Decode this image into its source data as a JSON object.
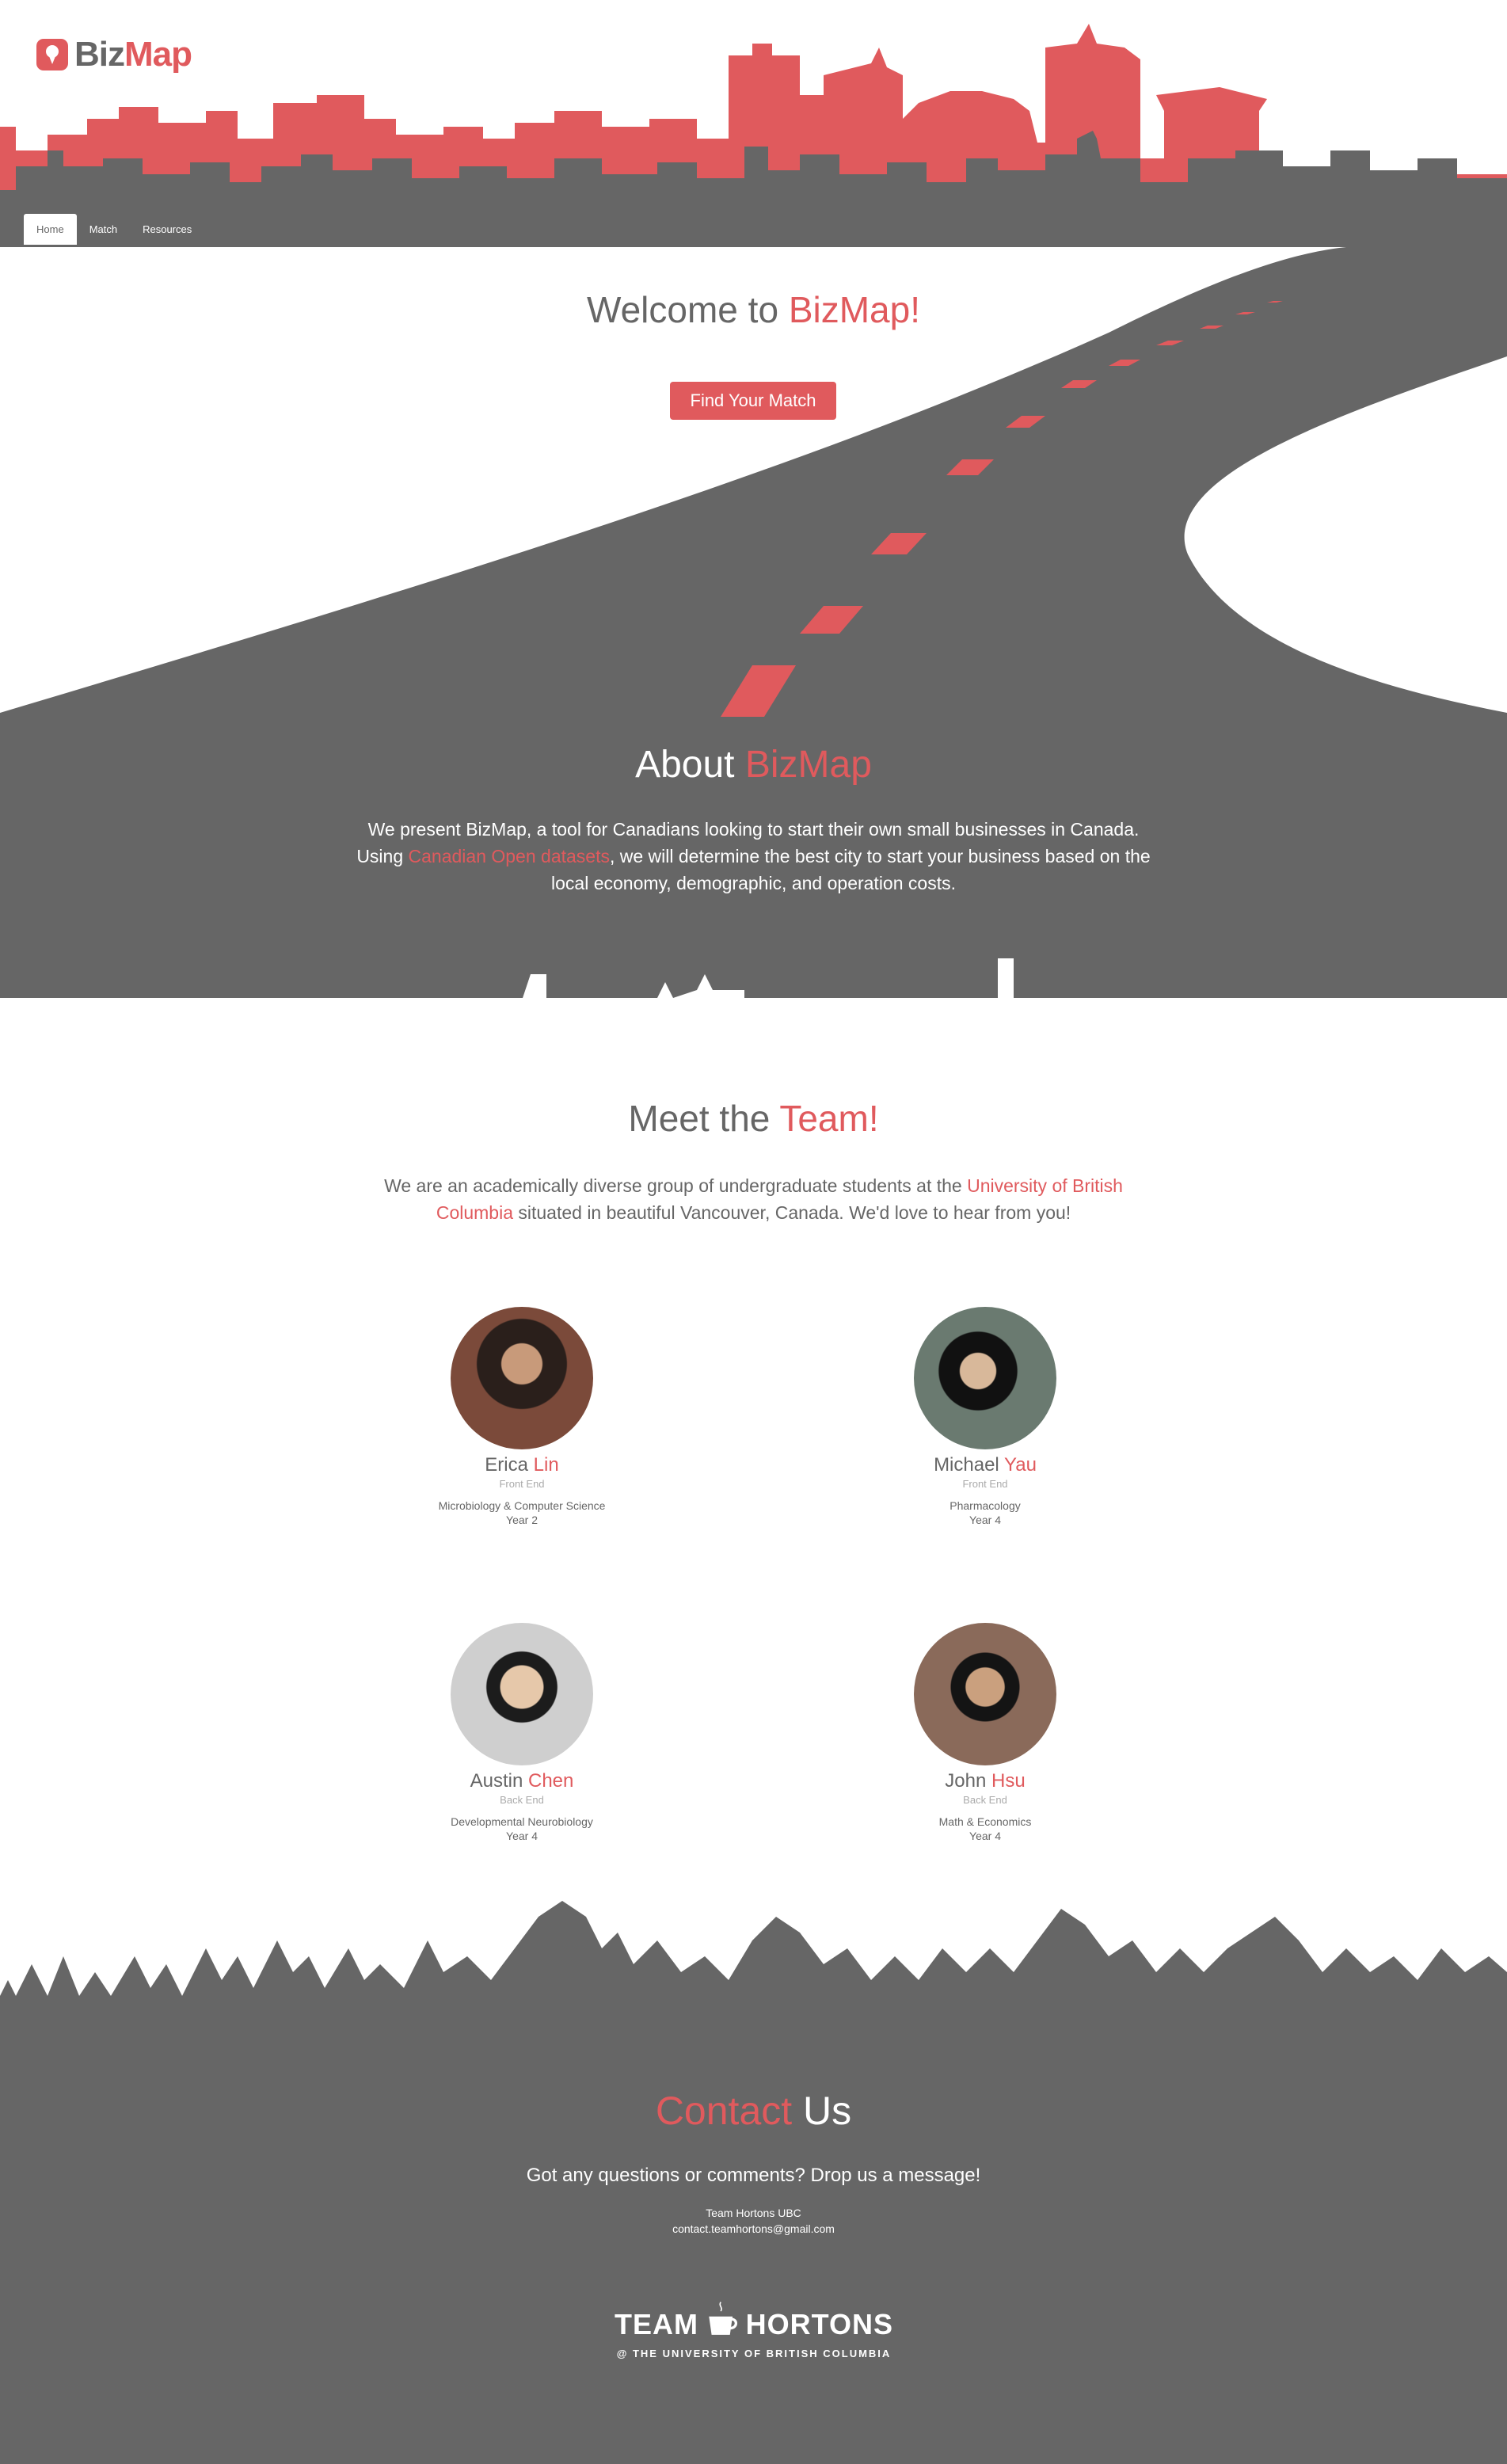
{
  "brand": {
    "logo_biz": "Biz",
    "logo_map": "Map"
  },
  "nav": {
    "items": [
      "Home",
      "Match",
      "Resources"
    ],
    "active": "Home"
  },
  "hero": {
    "title_prefix": "Welcome to ",
    "title_accent": "BizMap!",
    "cta_label": "Find Your Match"
  },
  "about": {
    "title_prefix": "About ",
    "title_accent": "BizMap",
    "line1": "We present BizMap, a tool for Canadians looking to start their own small businesses in Canada.",
    "line2_prefix": "Using ",
    "line2_link": "Canadian Open datasets",
    "line2_suffix": ", we will determine the best city to start your business based on the",
    "line3": "local economy, demographic, and operation costs."
  },
  "team": {
    "title_prefix": "Meet the ",
    "title_accent": "Team!",
    "intro_prefix": "We are an academically diverse group of undergraduate students at the ",
    "intro_link_1": "University of British",
    "intro_link_2": "Columbia",
    "intro_suffix": " situated in beautiful Vancouver, Canada. We'd love to hear from you!",
    "members": [
      {
        "first": "Erica",
        "last": "Lin",
        "role": "Front End",
        "major": "Microbiology & Computer Science",
        "year": "Year 2"
      },
      {
        "first": "Michael",
        "last": "Yau",
        "role": "Front End",
        "major": "Pharmacology",
        "year": "Year 4"
      },
      {
        "first": "Austin",
        "last": "Chen",
        "role": "Back End",
        "major": "Developmental Neurobiology",
        "year": "Year 4"
      },
      {
        "first": "John",
        "last": "Hsu",
        "role": "Back End",
        "major": "Math & Economics",
        "year": "Year 4"
      }
    ]
  },
  "contact": {
    "title_accent": "Contact",
    "title_suffix": " Us",
    "text": "Got any questions or comments? Drop us a message!",
    "org": "Team Hortons UBC",
    "email": "contact.teamhortons@gmail.com"
  },
  "footer": {
    "logo_left": "TEAM",
    "logo_right": "HORTONS",
    "logo_sub": "@ THE UNIVERSITY OF BRITISH COLUMBIA"
  },
  "colors": {
    "accent": "#e05a5d",
    "dark": "#666666",
    "white": "#ffffff"
  }
}
